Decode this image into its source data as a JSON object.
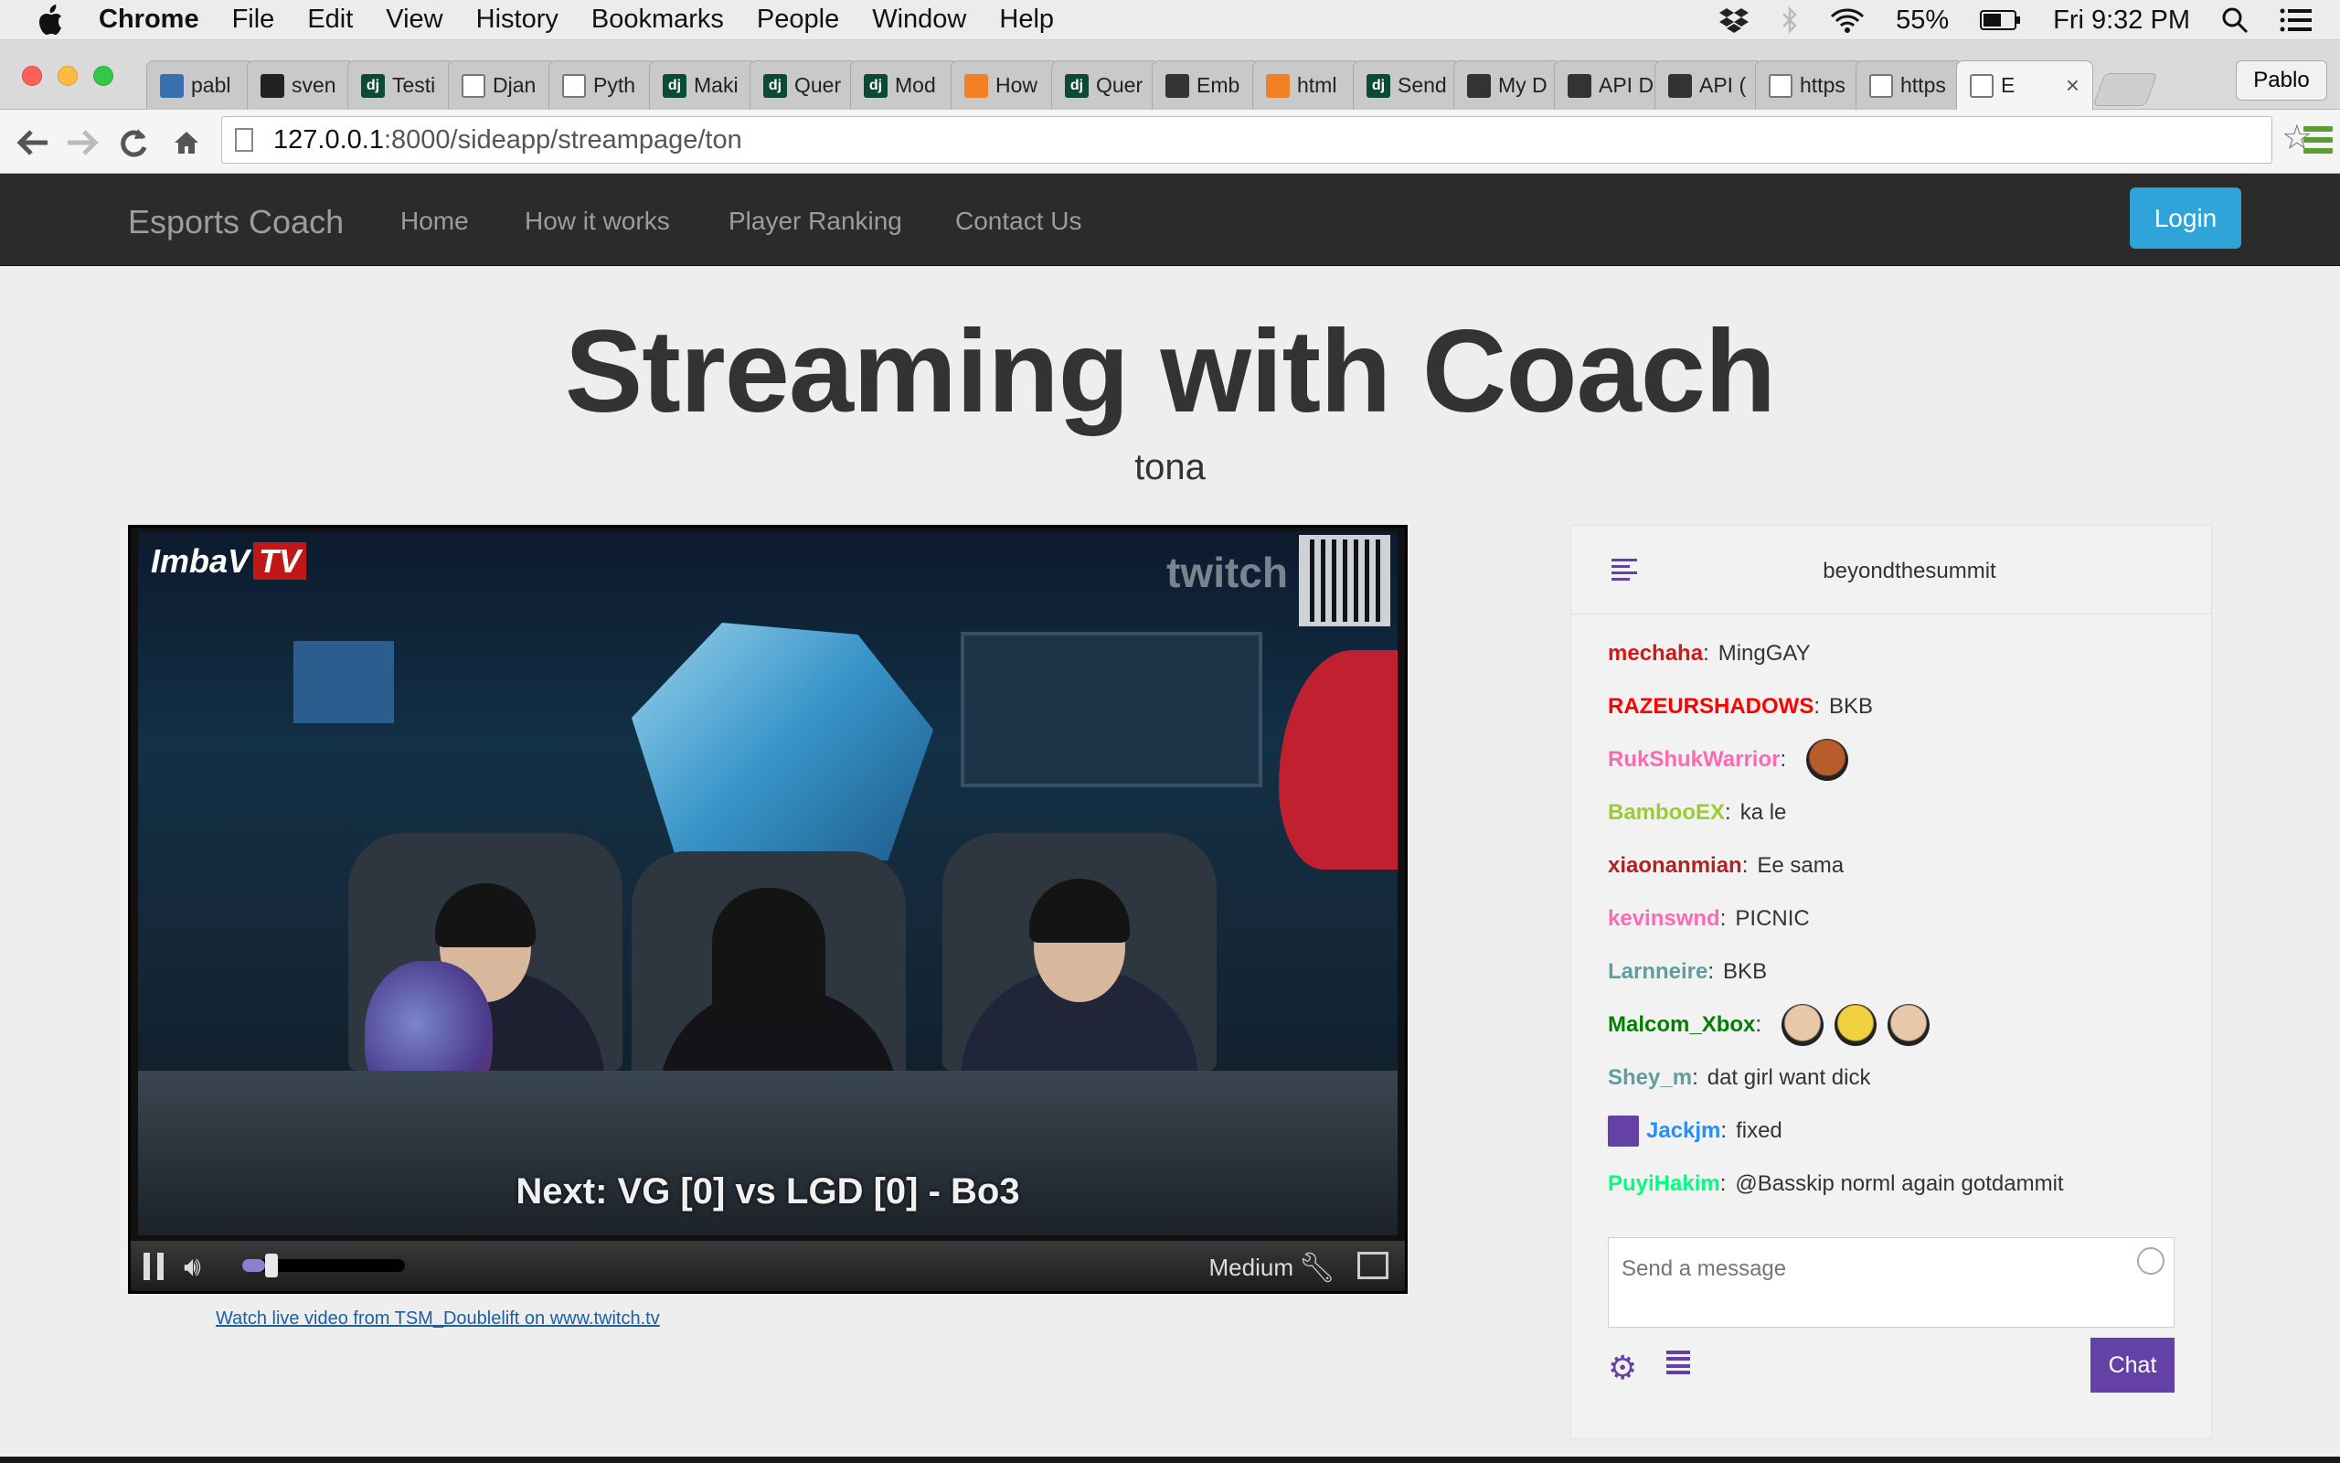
{
  "menubar": {
    "app": "Chrome",
    "items": [
      "File",
      "Edit",
      "View",
      "History",
      "Bookmarks",
      "People",
      "Window",
      "Help"
    ],
    "battery": "55%",
    "clock": "Fri 9:32 PM"
  },
  "tabs": [
    {
      "label": "pabl",
      "icon": "database-icon",
      "color": "#3a6fb0"
    },
    {
      "label": "sven",
      "icon": "github-icon",
      "color": "#222222"
    },
    {
      "label": "Testi",
      "icon": "django-icon",
      "color": "#0c4b33"
    },
    {
      "label": "Djan",
      "icon": "page-icon",
      "color": "#ffffff"
    },
    {
      "label": "Pyth",
      "icon": "page-icon",
      "color": "#ffffff"
    },
    {
      "label": "Maki",
      "icon": "django-icon",
      "color": "#0c4b33"
    },
    {
      "label": "Quer",
      "icon": "django-icon",
      "color": "#0c4b33"
    },
    {
      "label": "Mod",
      "icon": "django-icon",
      "color": "#0c4b33"
    },
    {
      "label": "How",
      "icon": "stackoverflow-icon",
      "color": "#f48024"
    },
    {
      "label": "Quer",
      "icon": "django-icon",
      "color": "#0c4b33"
    },
    {
      "label": "Emb",
      "icon": "squarespace-icon",
      "color": "#333333"
    },
    {
      "label": "html",
      "icon": "stackoverflow-icon",
      "color": "#f48024"
    },
    {
      "label": "Send",
      "icon": "django-icon",
      "color": "#0c4b33"
    },
    {
      "label": "My D",
      "icon": "heart-icon",
      "color": "#333333"
    },
    {
      "label": "API D",
      "icon": "heart-icon",
      "color": "#333333"
    },
    {
      "label": "API (",
      "icon": "heart-icon",
      "color": "#333333"
    },
    {
      "label": "https",
      "icon": "page-icon",
      "color": "#ffffff"
    },
    {
      "label": "https",
      "icon": "page-icon",
      "color": "#ffffff"
    },
    {
      "label": "E",
      "icon": "audio-icon",
      "color": "#ffffff",
      "active": true
    }
  ],
  "profile": "Pablo",
  "address": {
    "host": "127.0.0.1",
    "path": ":8000/sideapp/streampage/ton"
  },
  "site": {
    "brand": "Esports Coach",
    "nav": [
      "Home",
      "How it works",
      "Player Ranking",
      "Contact Us"
    ],
    "login": "Login",
    "title": "Streaming with Coach",
    "subtitle": "tona"
  },
  "player": {
    "channel_logo": "ImbaV",
    "channel_logo_tag": "TV",
    "watermark": "twitch",
    "caption": "Next: VG [0] vs LGD [0] - Bo3",
    "quality": "Medium",
    "volume_fraction": 0.14,
    "watch_link": "Watch live video from TSM_Doublelift on www.twitch.tv"
  },
  "chat": {
    "channel": "beyondthesummit",
    "messages": [
      {
        "user": "mechaha",
        "color": "#d41818",
        "text": "MingGAY"
      },
      {
        "user": "RAZEURSHADOWS",
        "color": "#ff0000",
        "text": "BKB"
      },
      {
        "user": "RukShukWarrior",
        "color": "#ff69b4",
        "text": "",
        "emotes": [
          "#b85c2c"
        ]
      },
      {
        "user": "BambooEX",
        "color": "#9acd32",
        "text": "ka le"
      },
      {
        "user": "xiaonanmian",
        "color": "#b22222",
        "text": "Ee sama"
      },
      {
        "user": "kevinswnd",
        "color": "#ff69b4",
        "text": "PICNIC"
      },
      {
        "user": "Larnneire",
        "color": "#5f9ea0",
        "text": "BKB"
      },
      {
        "user": "Malcom_Xbox",
        "color": "#008000",
        "text": "",
        "emotes": [
          "#e8c8a8",
          "#f0d040",
          "#e8c8a8"
        ]
      },
      {
        "user": "Shey_m",
        "color": "#5f9ea0",
        "text": "dat girl want dick"
      },
      {
        "user": "Jackjm",
        "color": "#1e90ff",
        "text": "fixed",
        "badge": true
      },
      {
        "user": "PuyiHakim",
        "color": "#00ff7f",
        "text": "@Basskip norml again gotdammit"
      }
    ],
    "input_placeholder": "Send a message",
    "send_label": "Chat"
  }
}
